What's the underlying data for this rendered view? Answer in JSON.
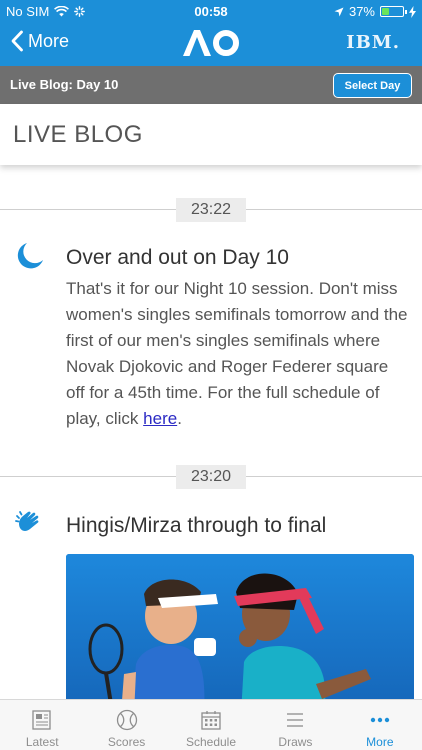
{
  "status": {
    "carrier": "No SIM",
    "time": "00:58",
    "battery": "37%",
    "battery_level": 0.37
  },
  "nav": {
    "back_label": "More",
    "brand": "IBM."
  },
  "subbar": {
    "title": "Live Blog: Day 10",
    "select_label": "Select Day"
  },
  "page": {
    "heading": "LIVE BLOG"
  },
  "entries": [
    {
      "time": "23:22",
      "icon": "moon-icon",
      "title": "Over and out on Day 10",
      "body": "That's it for our Night 10 session. Don't miss women's singles semifinals tomorrow and the first of our men's singles semifinals where Novak Djokovic and Roger Federer square off for a 45th time. For the full schedule of play, click ",
      "link": "here",
      "body_end": "."
    },
    {
      "time": "23:20",
      "icon": "clapping-hands-icon",
      "title": "Hingis/Mirza through to final"
    }
  ],
  "tabs": [
    {
      "label": "Latest",
      "icon": "newspaper-icon"
    },
    {
      "label": "Scores",
      "icon": "tennis-ball-icon"
    },
    {
      "label": "Schedule",
      "icon": "calendar-icon"
    },
    {
      "label": "Draws",
      "icon": "list-icon"
    },
    {
      "label": "More",
      "icon": "more-dots-icon"
    }
  ],
  "colors": {
    "brand_blue": "#1c8fd8",
    "subbar_gray": "#6f6f6f",
    "link": "#2b2ac4"
  }
}
